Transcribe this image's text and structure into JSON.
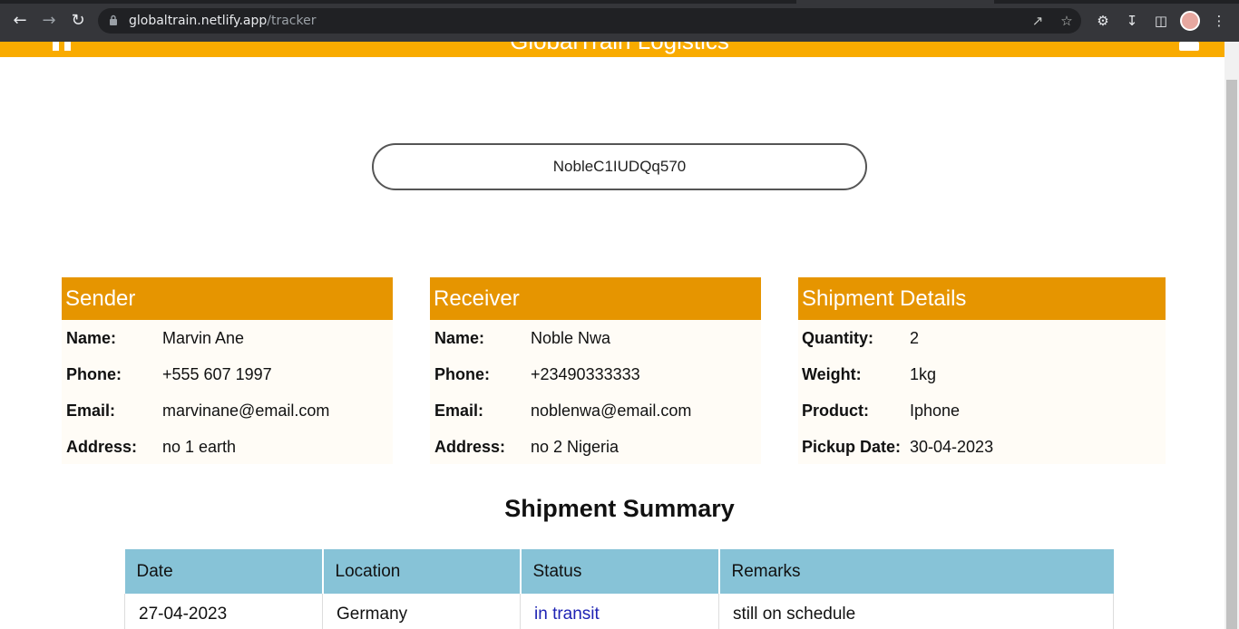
{
  "browser": {
    "url_host": "globaltrain.netlify.app",
    "url_path": "/tracker"
  },
  "header": {
    "brand": "GlobalTrain Logistics"
  },
  "tracker": {
    "value": "NobleC1IUDQq570"
  },
  "sender": {
    "title": "Sender",
    "rows": [
      {
        "label": "Name:",
        "value": "Marvin Ane"
      },
      {
        "label": "Phone:",
        "value": "+555 607 1997"
      },
      {
        "label": "Email:",
        "value": "marvinane@email.com"
      },
      {
        "label": "Address:",
        "value": "no 1 earth"
      }
    ]
  },
  "receiver": {
    "title": "Receiver",
    "rows": [
      {
        "label": "Name:",
        "value": "Noble Nwa"
      },
      {
        "label": "Phone:",
        "value": "+23490333333"
      },
      {
        "label": "Email:",
        "value": "noblenwa@email.com"
      },
      {
        "label": "Address:",
        "value": "no 2 Nigeria"
      }
    ]
  },
  "shipment": {
    "title": "Shipment Details",
    "rows": [
      {
        "label": "Quantity:",
        "value": "2"
      },
      {
        "label": "Weight:",
        "value": "1kg"
      },
      {
        "label": "Product:",
        "value": "Iphone"
      },
      {
        "label": "Pickup Date:",
        "value": "30-04-2023"
      }
    ]
  },
  "summary": {
    "title": "Shipment Summary",
    "columns": [
      "Date",
      "Location",
      "Status",
      "Remarks"
    ],
    "rows": [
      {
        "date": "27-04-2023",
        "location": "Germany",
        "status": "in transit",
        "remarks": "still on schedule"
      }
    ]
  }
}
